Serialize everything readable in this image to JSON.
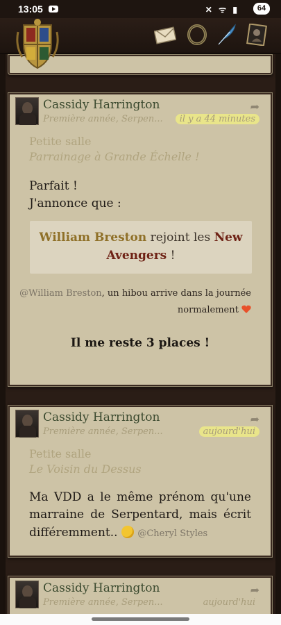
{
  "status_bar": {
    "time": "13:05",
    "icons": "✕ ᯤ ▮",
    "battery": "64"
  },
  "header": {
    "icons": [
      "crest-icon",
      "envelope-icon",
      "ring-icon",
      "quill-icon",
      "portrait-icon"
    ]
  },
  "posts": [
    {
      "author": "Cassidy Harrington",
      "rank": "Première année, Serpen...",
      "time": "il y a 44 minutes",
      "forum": "Petite salle",
      "thread": "Parrainage à Grande Échelle !",
      "lines": [
        "Parfait !",
        "J'annonce que :"
      ],
      "quote": {
        "name1": "William Breston",
        "middle": " rejoint les ",
        "name2": "New Avengers",
        "end": " !"
      },
      "mention": "@William Breston",
      "mention_text": ", un hibou arrive dans la journée",
      "mention_text2": "normalement",
      "final": "Il me reste 3 places !"
    },
    {
      "author": "Cassidy Harrington",
      "rank": "Première année, Serpen...",
      "time": "aujourd'hui",
      "forum": "Petite salle",
      "thread": "Le Voisin du Dessus",
      "text1": "Ma VDD a le même prénom qu'une",
      "text2": "marraine de Serpentard, mais écrit",
      "text3": "différemment..",
      "mention": "@Cheryl Styles"
    },
    {
      "author": "Cassidy Harrington",
      "rank": "Première année, Serpen...",
      "time": "aujourd'hui"
    }
  ]
}
